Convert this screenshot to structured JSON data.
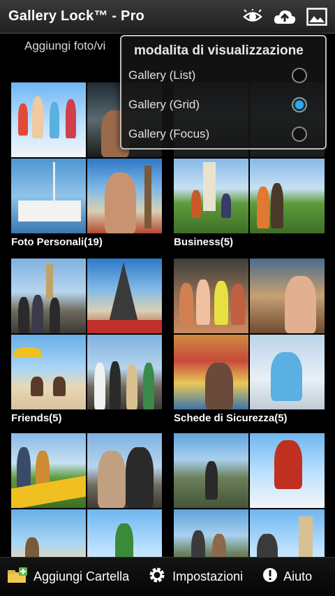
{
  "app": {
    "title": "Gallery Lock™ - Pro",
    "icons": [
      "eye-icon",
      "cloud-upload-icon",
      "image-icon"
    ]
  },
  "hint_text": "Aggiungi foto/vi",
  "popup": {
    "title": "modalita di visualizzazione",
    "options": [
      {
        "label": "Gallery (List)",
        "selected": false
      },
      {
        "label": "Gallery (Grid)",
        "selected": true
      },
      {
        "label": "Gallery (Focus)",
        "selected": false
      }
    ],
    "accent_color": "#2fa9ea"
  },
  "albums": [
    {
      "label": "Foto Personali(19)"
    },
    {
      "label": "Business(5)"
    },
    {
      "label": "Friends(5)"
    },
    {
      "label": "Schede di Sicurezza(5)"
    },
    {
      "label": ""
    },
    {
      "label": ""
    }
  ],
  "bottom_bar": {
    "add_folder": "Aggiungi Cartella",
    "settings": "Impostazioni",
    "help": "Aiuto"
  }
}
